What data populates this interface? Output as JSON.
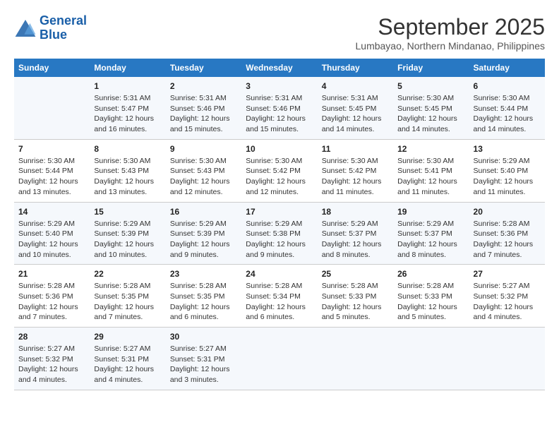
{
  "header": {
    "logo_line1": "General",
    "logo_line2": "Blue",
    "month": "September 2025",
    "location": "Lumbayao, Northern Mindanao, Philippines"
  },
  "days_of_week": [
    "Sunday",
    "Monday",
    "Tuesday",
    "Wednesday",
    "Thursday",
    "Friday",
    "Saturday"
  ],
  "weeks": [
    [
      {
        "day": "",
        "info": ""
      },
      {
        "day": "1",
        "info": "Sunrise: 5:31 AM\nSunset: 5:47 PM\nDaylight: 12 hours\nand 16 minutes."
      },
      {
        "day": "2",
        "info": "Sunrise: 5:31 AM\nSunset: 5:46 PM\nDaylight: 12 hours\nand 15 minutes."
      },
      {
        "day": "3",
        "info": "Sunrise: 5:31 AM\nSunset: 5:46 PM\nDaylight: 12 hours\nand 15 minutes."
      },
      {
        "day": "4",
        "info": "Sunrise: 5:31 AM\nSunset: 5:45 PM\nDaylight: 12 hours\nand 14 minutes."
      },
      {
        "day": "5",
        "info": "Sunrise: 5:30 AM\nSunset: 5:45 PM\nDaylight: 12 hours\nand 14 minutes."
      },
      {
        "day": "6",
        "info": "Sunrise: 5:30 AM\nSunset: 5:44 PM\nDaylight: 12 hours\nand 14 minutes."
      }
    ],
    [
      {
        "day": "7",
        "info": "Sunrise: 5:30 AM\nSunset: 5:44 PM\nDaylight: 12 hours\nand 13 minutes."
      },
      {
        "day": "8",
        "info": "Sunrise: 5:30 AM\nSunset: 5:43 PM\nDaylight: 12 hours\nand 13 minutes."
      },
      {
        "day": "9",
        "info": "Sunrise: 5:30 AM\nSunset: 5:43 PM\nDaylight: 12 hours\nand 12 minutes."
      },
      {
        "day": "10",
        "info": "Sunrise: 5:30 AM\nSunset: 5:42 PM\nDaylight: 12 hours\nand 12 minutes."
      },
      {
        "day": "11",
        "info": "Sunrise: 5:30 AM\nSunset: 5:42 PM\nDaylight: 12 hours\nand 11 minutes."
      },
      {
        "day": "12",
        "info": "Sunrise: 5:30 AM\nSunset: 5:41 PM\nDaylight: 12 hours\nand 11 minutes."
      },
      {
        "day": "13",
        "info": "Sunrise: 5:29 AM\nSunset: 5:40 PM\nDaylight: 12 hours\nand 11 minutes."
      }
    ],
    [
      {
        "day": "14",
        "info": "Sunrise: 5:29 AM\nSunset: 5:40 PM\nDaylight: 12 hours\nand 10 minutes."
      },
      {
        "day": "15",
        "info": "Sunrise: 5:29 AM\nSunset: 5:39 PM\nDaylight: 12 hours\nand 10 minutes."
      },
      {
        "day": "16",
        "info": "Sunrise: 5:29 AM\nSunset: 5:39 PM\nDaylight: 12 hours\nand 9 minutes."
      },
      {
        "day": "17",
        "info": "Sunrise: 5:29 AM\nSunset: 5:38 PM\nDaylight: 12 hours\nand 9 minutes."
      },
      {
        "day": "18",
        "info": "Sunrise: 5:29 AM\nSunset: 5:37 PM\nDaylight: 12 hours\nand 8 minutes."
      },
      {
        "day": "19",
        "info": "Sunrise: 5:29 AM\nSunset: 5:37 PM\nDaylight: 12 hours\nand 8 minutes."
      },
      {
        "day": "20",
        "info": "Sunrise: 5:28 AM\nSunset: 5:36 PM\nDaylight: 12 hours\nand 7 minutes."
      }
    ],
    [
      {
        "day": "21",
        "info": "Sunrise: 5:28 AM\nSunset: 5:36 PM\nDaylight: 12 hours\nand 7 minutes."
      },
      {
        "day": "22",
        "info": "Sunrise: 5:28 AM\nSunset: 5:35 PM\nDaylight: 12 hours\nand 7 minutes."
      },
      {
        "day": "23",
        "info": "Sunrise: 5:28 AM\nSunset: 5:35 PM\nDaylight: 12 hours\nand 6 minutes."
      },
      {
        "day": "24",
        "info": "Sunrise: 5:28 AM\nSunset: 5:34 PM\nDaylight: 12 hours\nand 6 minutes."
      },
      {
        "day": "25",
        "info": "Sunrise: 5:28 AM\nSunset: 5:33 PM\nDaylight: 12 hours\nand 5 minutes."
      },
      {
        "day": "26",
        "info": "Sunrise: 5:28 AM\nSunset: 5:33 PM\nDaylight: 12 hours\nand 5 minutes."
      },
      {
        "day": "27",
        "info": "Sunrise: 5:27 AM\nSunset: 5:32 PM\nDaylight: 12 hours\nand 4 minutes."
      }
    ],
    [
      {
        "day": "28",
        "info": "Sunrise: 5:27 AM\nSunset: 5:32 PM\nDaylight: 12 hours\nand 4 minutes."
      },
      {
        "day": "29",
        "info": "Sunrise: 5:27 AM\nSunset: 5:31 PM\nDaylight: 12 hours\nand 4 minutes."
      },
      {
        "day": "30",
        "info": "Sunrise: 5:27 AM\nSunset: 5:31 PM\nDaylight: 12 hours\nand 3 minutes."
      },
      {
        "day": "",
        "info": ""
      },
      {
        "day": "",
        "info": ""
      },
      {
        "day": "",
        "info": ""
      },
      {
        "day": "",
        "info": ""
      }
    ]
  ]
}
